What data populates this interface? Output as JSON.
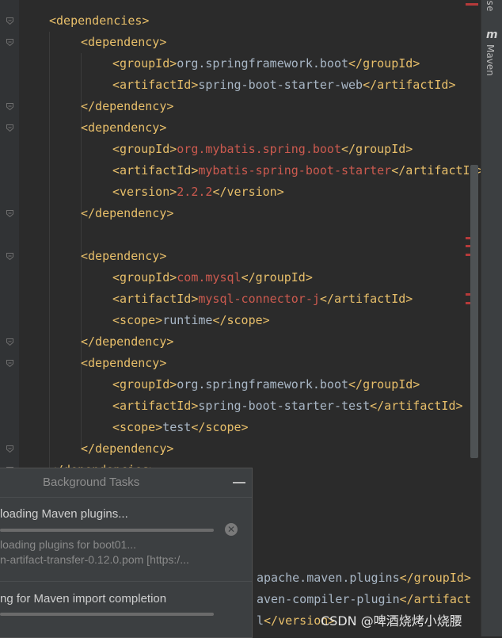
{
  "editor": {
    "lines": [
      {
        "indent": 1,
        "parts": [
          {
            "t": "<dependencies>",
            "c": "tag"
          }
        ]
      },
      {
        "indent": 2,
        "parts": [
          {
            "t": "<dependency>",
            "c": "tag"
          }
        ]
      },
      {
        "indent": 3,
        "parts": [
          {
            "t": "<groupId>",
            "c": "tag"
          },
          {
            "t": "org.springframework.boot",
            "c": "val"
          },
          {
            "t": "</groupId>",
            "c": "tag"
          }
        ]
      },
      {
        "indent": 3,
        "parts": [
          {
            "t": "<artifactId>",
            "c": "tag"
          },
          {
            "t": "spring-boot-starter-web",
            "c": "val"
          },
          {
            "t": "</artifactId>",
            "c": "tag"
          }
        ]
      },
      {
        "indent": 2,
        "parts": [
          {
            "t": "</dependency>",
            "c": "tag"
          }
        ]
      },
      {
        "indent": 2,
        "parts": [
          {
            "t": "<dependency>",
            "c": "tag"
          }
        ]
      },
      {
        "indent": 3,
        "parts": [
          {
            "t": "<groupId>",
            "c": "tag"
          },
          {
            "t": "org.mybatis.spring.boot",
            "c": "valred"
          },
          {
            "t": "</groupId>",
            "c": "tag"
          }
        ]
      },
      {
        "indent": 3,
        "parts": [
          {
            "t": "<artifactId>",
            "c": "tag"
          },
          {
            "t": "mybatis-spring-boot-starter",
            "c": "valred"
          },
          {
            "t": "</artifactId>",
            "c": "tag"
          }
        ]
      },
      {
        "indent": 3,
        "parts": [
          {
            "t": "<version>",
            "c": "tag"
          },
          {
            "t": "2.2.2",
            "c": "valred"
          },
          {
            "t": "</version>",
            "c": "tag"
          }
        ]
      },
      {
        "indent": 2,
        "parts": [
          {
            "t": "</dependency>",
            "c": "tag"
          }
        ]
      },
      {
        "indent": 0,
        "parts": []
      },
      {
        "indent": 2,
        "parts": [
          {
            "t": "<dependency>",
            "c": "tag"
          }
        ]
      },
      {
        "indent": 3,
        "parts": [
          {
            "t": "<groupId>",
            "c": "tag"
          },
          {
            "t": "com.mysql",
            "c": "valred"
          },
          {
            "t": "</groupId>",
            "c": "tag"
          }
        ]
      },
      {
        "indent": 3,
        "parts": [
          {
            "t": "<artifactId>",
            "c": "tag"
          },
          {
            "t": "mysql-connector-j",
            "c": "valred"
          },
          {
            "t": "</artifactId>",
            "c": "tag"
          }
        ]
      },
      {
        "indent": 3,
        "parts": [
          {
            "t": "<scope>",
            "c": "tag"
          },
          {
            "t": "runtime",
            "c": "val"
          },
          {
            "t": "</scope>",
            "c": "tag"
          }
        ]
      },
      {
        "indent": 2,
        "parts": [
          {
            "t": "</dependency>",
            "c": "tag"
          }
        ]
      },
      {
        "indent": 2,
        "parts": [
          {
            "t": "<dependency>",
            "c": "tag"
          }
        ]
      },
      {
        "indent": 3,
        "parts": [
          {
            "t": "<groupId>",
            "c": "tag"
          },
          {
            "t": "org.springframework.boot",
            "c": "val"
          },
          {
            "t": "</groupId>",
            "c": "tag"
          }
        ]
      },
      {
        "indent": 3,
        "parts": [
          {
            "t": "<artifactId>",
            "c": "tag"
          },
          {
            "t": "spring-boot-starter-test",
            "c": "val"
          },
          {
            "t": "</artifactId>",
            "c": "tag"
          }
        ]
      },
      {
        "indent": 3,
        "parts": [
          {
            "t": "<scope>",
            "c": "tag"
          },
          {
            "t": "test",
            "c": "val"
          },
          {
            "t": "</scope>",
            "c": "tag"
          }
        ]
      },
      {
        "indent": 2,
        "parts": [
          {
            "t": "</dependency>",
            "c": "tag"
          }
        ]
      },
      {
        "indent": 1,
        "parts": [
          {
            "t": "</dependencies>",
            "c": "tag"
          }
        ]
      }
    ],
    "hidden_lines": [
      {
        "parts": [
          {
            "t": "apache.maven.plugins",
            "c": "val"
          },
          {
            "t": "</groupId>",
            "c": "tag"
          }
        ]
      },
      {
        "parts": [
          {
            "t": "aven-compiler-plugin",
            "c": "val"
          },
          {
            "t": "</artifact",
            "c": "tag"
          }
        ]
      },
      {
        "parts": [
          {
            "t": "l",
            "c": "val"
          },
          {
            "t": "</version>",
            "c": "tag"
          }
        ]
      }
    ]
  },
  "right_toolbar": {
    "top_label": "se",
    "maven_icon": "m",
    "maven_label": "Maven"
  },
  "background_tasks": {
    "title": "Background Tasks",
    "tasks": [
      {
        "title": "loading Maven plugins...",
        "subtitle1": "loading plugins for boot01...",
        "subtitle2": "n-artifact-transfer-0.12.0.pom [https:/..."
      },
      {
        "title": "ng for Maven import completion"
      }
    ]
  },
  "watermark": "CSDN @啤酒烧烤小烧腰",
  "colors": {
    "background": "#2b2b2b",
    "tag": "#e8bf6a",
    "value": "#a9b7c6",
    "unresolved": "#cc5a4f",
    "error_marker": "#b63a3a"
  }
}
